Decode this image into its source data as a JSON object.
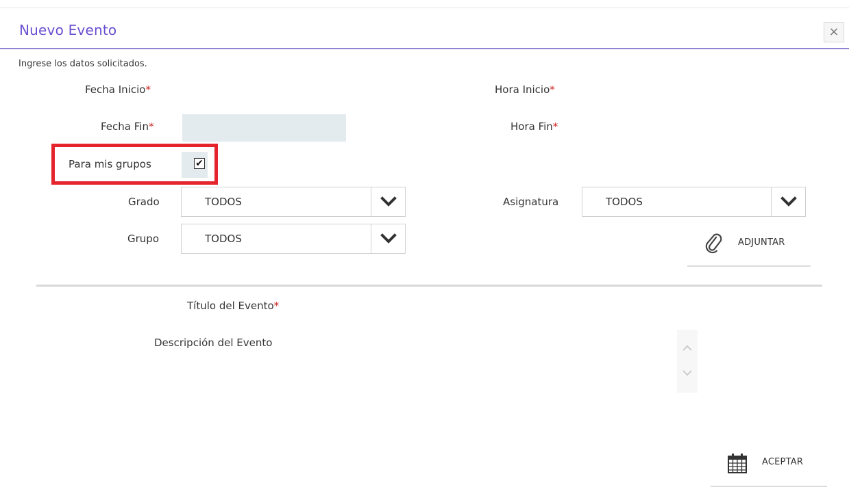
{
  "dialog": {
    "title": "Nuevo Evento",
    "close_icon": "×",
    "instructions": "Ingrese los datos solicitados."
  },
  "form": {
    "fecha_inicio_label": "Fecha Inicio",
    "hora_inicio_label": "Hora Inicio",
    "fecha_fin_label": "Fecha Fin",
    "hora_fin_label": "Hora Fin",
    "required_mark": "*",
    "para_mis_grupos_label": "Para mis grupos",
    "para_mis_grupos_checked": true,
    "check_glyph": "✔",
    "grado_label": "Grado",
    "grado_value": "TODOS",
    "grupo_label": "Grupo",
    "grupo_value": "TODOS",
    "asignatura_label": "Asignatura",
    "asignatura_value": "TODOS",
    "titulo_label": "Título del Evento",
    "descripcion_label": "Descripción del Evento"
  },
  "actions": {
    "adjuntar_label": "ADJUNTAR",
    "adjuntar_icon": "paperclip-icon",
    "aceptar_label": "ACEPTAR",
    "aceptar_icon": "calendar-icon"
  },
  "colors": {
    "title": "#6a4fd1",
    "header_rule": "#8f82d4",
    "highlight": "#e5252e",
    "required": "#cc2a2a",
    "field_bg": "#e4ebee"
  }
}
